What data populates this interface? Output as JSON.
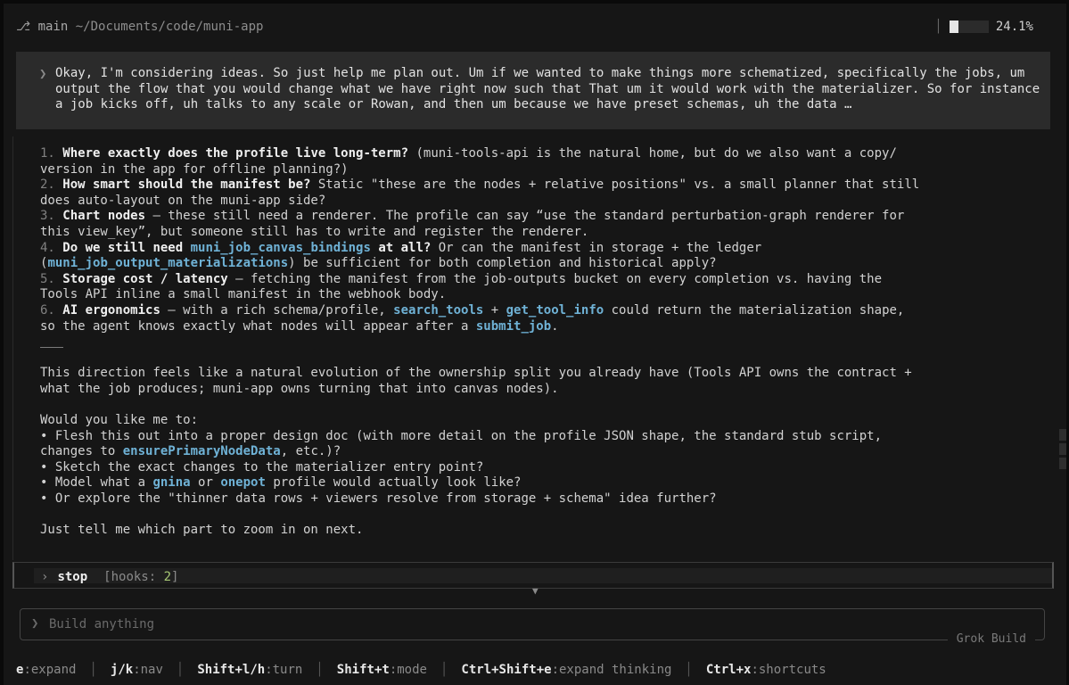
{
  "topbar": {
    "branch_icon": "⎇",
    "branch": "main",
    "path": "~/Documents/code/muni-app",
    "context_percent_label": "24.1%",
    "context_fraction": 0.241
  },
  "prompt": {
    "chevron": "❯",
    "text": "Okay, I'm considering ideas. So just help me plan out. Um if we wanted to make things more schematized, specifically the jobs, um output the flow that you would change what we have right now such that That um it would work with the materializer. So for instance a job kicks off, uh talks to any scale or Rowan, and then um because we have preset schemas, uh the data …"
  },
  "questions": [
    {
      "n": "1.",
      "b": "Where exactly does the profile live long-term?",
      "t1": " (muni-tools-api is the natural home, but do we also want a copy/",
      "t2": "version in the app for offline planning?)"
    },
    {
      "n": "2.",
      "b": "How smart should the manifest be?",
      "t1": " Static \"these are the nodes + relative positions\" vs. a small planner that still",
      "t2": "does auto-layout on the muni-app side?"
    },
    {
      "n": "3.",
      "b": "Chart nodes",
      "t1": " — these still need a renderer. The profile can say “use the standard perturbation-graph renderer for",
      "t2": "this view_key”, but someone still has to write and register the renderer."
    },
    {
      "n": "4.",
      "b1": "Do we still need ",
      "c1": "muni_job_canvas_bindings",
      "b2": " at all?",
      "t1": " Or can the manifest in storage + the ledger",
      "l2a": "(",
      "c2": "muni_job_output_materializations",
      "l2b": ") be sufficient for both completion and historical apply?"
    },
    {
      "n": "5.",
      "b": "Storage cost / latency",
      "t1": " — fetching the manifest from the job-outputs bucket on every completion vs. having the",
      "t2": "Tools API inline a small manifest in the webhook body."
    },
    {
      "n": "6.",
      "b": "AI ergonomics",
      "t1a": " — with a rich schema/profile, ",
      "c1": "search_tools",
      "t1b": " + ",
      "c2": "get_tool_info",
      "t1c": " could return the materialization shape,",
      "t2a": "so the agent knows exactly what nodes will appear after a ",
      "c3": "submit_job",
      "t2b": "."
    }
  ],
  "direction": {
    "line1": "This direction feels like a natural evolution of the ownership split you already have (Tools API owns the contract +",
    "line2": "what the job produces; muni-app owns turning that into canvas nodes)."
  },
  "offer": {
    "intro": "Would you like me to:",
    "bullet": "•",
    "b1_l1": " Flesh this out into a proper design doc (with more detail on the profile JSON shape, the standard stub script,",
    "b1_l2a": "changes to ",
    "b1_code": "ensurePrimaryNodeData",
    "b1_l2b": ", etc.)?",
    "b2": " Sketch the exact changes to the materializer entry point?",
    "b3a": " Model what a ",
    "b3_code1": "gnina",
    "b3b": " or ",
    "b3_code2": "onepot",
    "b3c": " profile would actually look like?",
    "b4": " Or explore the \"thinner data rows + viewers resolve from storage + schema\" idea further?",
    "closing": "Just tell me which part to zoom in on next."
  },
  "stop_row": {
    "chevron": "›",
    "label": "stop",
    "hooks_prefix": "[hooks: ",
    "hooks_count": "2",
    "hooks_suffix": "]"
  },
  "scroll_arrow": "▼",
  "input": {
    "chevron": "❯",
    "placeholder": "Build anything",
    "brand": "Grok Build"
  },
  "footer": [
    {
      "key": "e",
      "desc": ":expand"
    },
    {
      "key": "j/k",
      "desc": ":nav"
    },
    {
      "key": "Shift+l/h",
      "desc": ":turn"
    },
    {
      "key": "Shift+t",
      "desc": ":mode"
    },
    {
      "key": "Ctrl+Shift+e",
      "desc": ":expand thinking"
    },
    {
      "key": "Ctrl+x",
      "desc": ":shortcuts"
    }
  ]
}
